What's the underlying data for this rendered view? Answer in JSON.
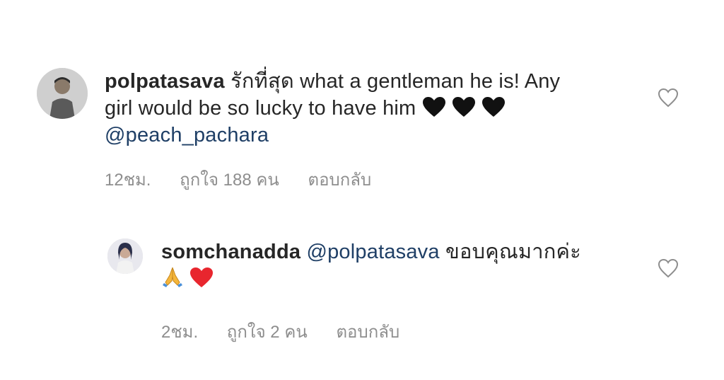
{
  "comments": [
    {
      "username": "polpatasava",
      "text_parts": [
        "รักที่สุด what a gentleman he is! Any girl would be so lucky to have him ",
        "@peach_pachara"
      ],
      "time": "12ชม.",
      "likes": "ถูกใจ 188 คน",
      "reply": "ตอบกลับ"
    },
    {
      "username": "somchanadda",
      "text_parts": [
        "@polpatasava",
        " ขอบคุณมากค่ะ"
      ],
      "time": "2ชม.",
      "likes": "ถูกใจ 2 คน",
      "reply": "ตอบกลับ"
    }
  ],
  "colors": {
    "text": "#262626",
    "mention": "#1f3f66",
    "meta": "#8e8e8e"
  },
  "icons": [
    "heart-outline-icon",
    "black-heart-emoji",
    "folded-hands-emoji",
    "red-heart-emoji"
  ]
}
